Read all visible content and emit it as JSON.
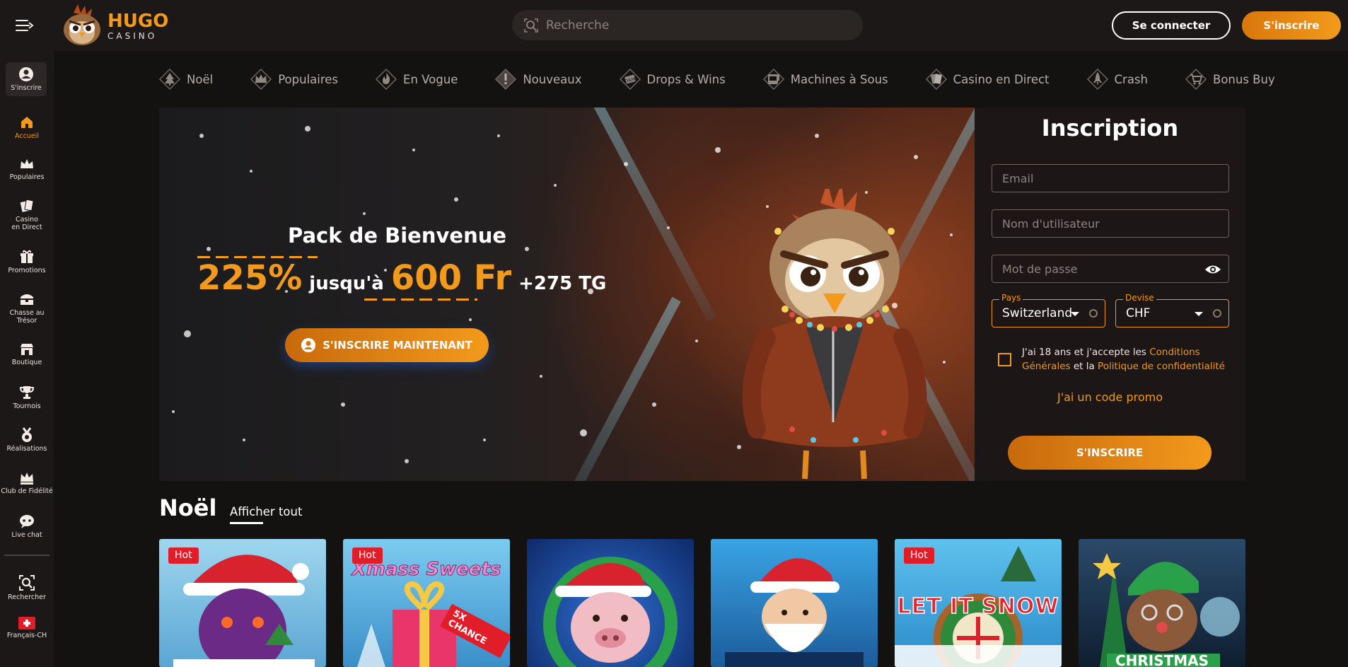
{
  "header": {
    "logo_line1": "HUGO",
    "logo_line2": "CASINO",
    "search_placeholder": "Recherche",
    "login_label": "Se connecter",
    "signup_label": "S'inscrire"
  },
  "sidebar": {
    "items": [
      {
        "label": "S'inscrire",
        "icon": "user-icon"
      },
      {
        "label": "Accueil",
        "icon": "home-icon",
        "active": true
      },
      {
        "label": "Populaires",
        "icon": "crown-icon"
      },
      {
        "label": "Casino en Direct",
        "icon": "cards-icon"
      },
      {
        "label": "Promotions",
        "icon": "gift-icon"
      },
      {
        "label": "Chasse au Trésor",
        "icon": "treasure-icon"
      },
      {
        "label": "Boutique",
        "icon": "shop-icon"
      },
      {
        "label": "Tournois",
        "icon": "trophy-icon"
      },
      {
        "label": "Réalisations",
        "icon": "medal-icon"
      },
      {
        "label": "Club de Fidélité",
        "icon": "crown-icon"
      },
      {
        "label": "Live chat",
        "icon": "chat-icon"
      },
      {
        "label": "Rechercher",
        "icon": "search-icon"
      },
      {
        "label": "Français-CH",
        "icon": "swiss-flag-icon"
      }
    ]
  },
  "categories": [
    {
      "label": "Noël",
      "icon": "tree-icon"
    },
    {
      "label": "Populaires",
      "icon": "crown-icon"
    },
    {
      "label": "En Vogue",
      "icon": "flame-icon"
    },
    {
      "label": "Nouveaux",
      "icon": "exclamation-icon"
    },
    {
      "label": "Drops & Wins",
      "icon": "drops-icon"
    },
    {
      "label": "Machines à Sous",
      "icon": "slot-icon"
    },
    {
      "label": "Casino en Direct",
      "icon": "cards-icon"
    },
    {
      "label": "Crash",
      "icon": "rocket-icon"
    },
    {
      "label": "Bonus Buy",
      "icon": "cart-icon"
    }
  ],
  "hero": {
    "title": "Pack de Bienvenue",
    "percent": "225%",
    "upto": "jusqu'à",
    "amount": "600 Fr",
    "extra": "+275 TG",
    "cta": "S'INSCRIRE MAINTENANT"
  },
  "form": {
    "title": "Inscription",
    "email_placeholder": "Email",
    "username_placeholder": "Nom d'utilisateur",
    "password_placeholder": "Mot de passe",
    "country_label": "Pays",
    "country_value": "Switzerland",
    "currency_label": "Devise",
    "currency_value": "CHF",
    "terms_pre": "J'ai 18 ans et j'accepte les ",
    "terms_link1": "Conditions Générales",
    "terms_mid": " et la ",
    "terms_link2": "Politique de confidentialité",
    "promo_link": "J'ai un code promo",
    "submit": "S'INSCRIRE"
  },
  "section": {
    "title": "Noël",
    "view_all": "Afficher tout"
  },
  "games": [
    {
      "badge": "Hot",
      "bg": "#7ec6e8"
    },
    {
      "badge": "Hot",
      "title": "Xmass Sweets",
      "sub": "5X CHANCE",
      "bg": "#5ab4e0"
    },
    {
      "badge": "",
      "bg": "#1f4fa8"
    },
    {
      "badge": "",
      "bg": "#2a8fd4"
    },
    {
      "badge": "Hot",
      "title": "LET IT SNOW",
      "bg": "#3fa7dc"
    },
    {
      "badge": "",
      "title": "CHRISTMAS",
      "bg": "#1e3a5c"
    }
  ],
  "colors": {
    "accent": "#f39a1c",
    "bg": "#141111",
    "panel": "#1d1818",
    "hot": "#e11d2a"
  }
}
